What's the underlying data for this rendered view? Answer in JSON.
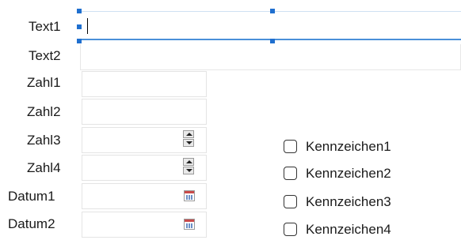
{
  "form": {
    "labels": {
      "text1": "Text1",
      "text2": "Text2",
      "zahl1": "Zahl1",
      "zahl2": "Zahl2",
      "zahl3": "Zahl3",
      "zahl4": "Zahl4",
      "datum1": "Datum1",
      "datum2": "Datum2"
    },
    "checkboxes": [
      "Kennzeichen1",
      "Kennzeichen2",
      "Kennzeichen3",
      "Kennzeichen4"
    ],
    "icons": {
      "spin": "up-down-spinner-icon",
      "calendar": "calendar-icon"
    },
    "colors": {
      "focus_border": "#4a90d9",
      "selection_handle": "#1f6fcf"
    }
  }
}
